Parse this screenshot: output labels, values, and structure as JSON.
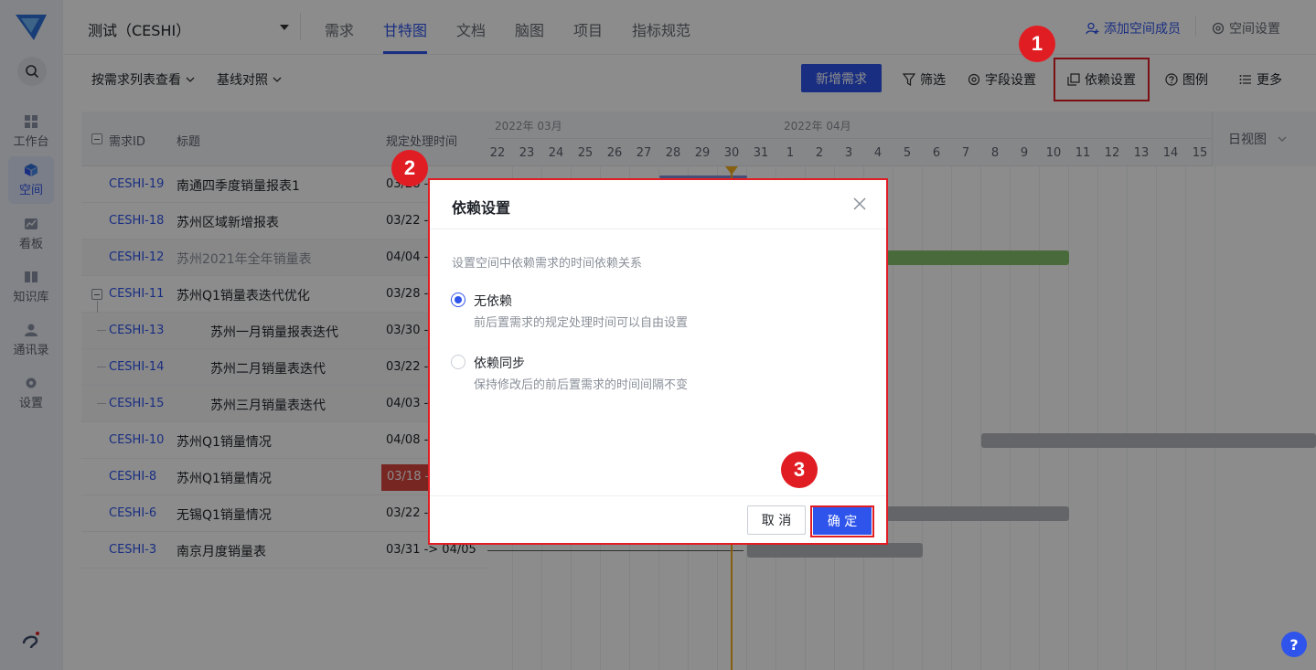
{
  "sidebar": {
    "items": [
      {
        "label": "工作台"
      },
      {
        "label": "空间"
      },
      {
        "label": "看板"
      },
      {
        "label": "知识库"
      },
      {
        "label": "通讯录"
      },
      {
        "label": "设置"
      }
    ]
  },
  "header": {
    "space_name": "测试（CESHI）",
    "tabs": [
      {
        "label": "需求"
      },
      {
        "label": "甘特图"
      },
      {
        "label": "文档"
      },
      {
        "label": "脑图"
      },
      {
        "label": "项目"
      },
      {
        "label": "指标规范"
      }
    ],
    "add_member": "添加空间成员",
    "space_settings": "空间设置"
  },
  "toolbar": {
    "view_by": "按需求列表查看",
    "baseline": "基线对照",
    "new_requirement": "新增需求",
    "filter": "筛选",
    "field_settings": "字段设置",
    "dependency_settings": "依赖设置",
    "legend": "图例",
    "more": "更多"
  },
  "table": {
    "headers": {
      "id": "需求ID",
      "title": "标题",
      "time": "规定处理时间"
    },
    "rows": [
      {
        "id": "CESHI-19",
        "title": "南通四季度销量报表1",
        "time": "03/28 -"
      },
      {
        "id": "CESHI-18",
        "title": "苏州区域新增报表",
        "time": "03/22 -"
      },
      {
        "id": "CESHI-12",
        "title": "苏州2021年全年销量表",
        "time": "04/04 -"
      },
      {
        "id": "CESHI-11",
        "title": "苏州Q1销量表迭代优化",
        "time": "03/28 -"
      },
      {
        "id": "CESHI-13",
        "title": "苏州一月销量报表迭代",
        "time": "03/30 -"
      },
      {
        "id": "CESHI-14",
        "title": "苏州二月销量表迭代",
        "time": "03/22 -"
      },
      {
        "id": "CESHI-15",
        "title": "苏州三月销量表迭代",
        "time": "04/03 -"
      },
      {
        "id": "CESHI-10",
        "title": "苏州Q1销量情况",
        "time": "04/08 -"
      },
      {
        "id": "CESHI-8",
        "title": "苏州Q1销量情况",
        "time": "03/18 -"
      },
      {
        "id": "CESHI-6",
        "title": "无锡Q1销量情况",
        "time": "03/22 -"
      },
      {
        "id": "CESHI-3",
        "title": "南京月度销量表",
        "time": "03/31 -> 04/05"
      }
    ]
  },
  "gantt": {
    "months": [
      "2022年 03月",
      "2022年 04月"
    ],
    "days": [
      "22",
      "23",
      "24",
      "25",
      "26",
      "27",
      "28",
      "29",
      "30",
      "31",
      "1",
      "2",
      "3",
      "4",
      "5",
      "6",
      "7",
      "8",
      "9",
      "10",
      "11",
      "12",
      "13",
      "14",
      "15"
    ],
    "view_mode": "日视图"
  },
  "modal": {
    "title": "依赖设置",
    "description": "设置空间中依赖需求的时间依赖关系",
    "options": [
      {
        "label": "无依赖",
        "hint": "前后置需求的规定处理时间可以自由设置",
        "checked": true
      },
      {
        "label": "依赖同步",
        "hint": "保持修改后的前后置需求的时间间隔不变",
        "checked": false
      }
    ],
    "cancel": "取 消",
    "confirm": "确 定"
  },
  "steps": [
    "1",
    "2",
    "3"
  ],
  "help": "?",
  "colors": {
    "accent": "#2f54eb",
    "highlight": "#e11d24",
    "today": "#f2b01e"
  }
}
